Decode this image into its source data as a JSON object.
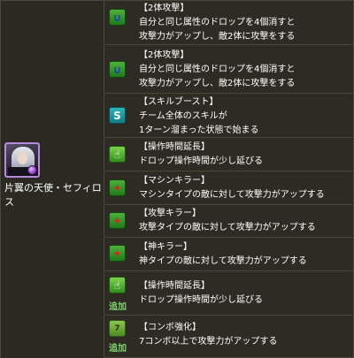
{
  "monster": {
    "name": "片翼の天使・セフィロス",
    "icon": "sephiroth-portrait",
    "attribute_color": "#b88adf"
  },
  "awakenings": [
    {
      "icon": "two-pronged-attack-icon",
      "title": "【2体攻撃】",
      "lines": [
        "自分と同じ属性のドロップを4個消すと",
        "攻撃力がアップし、敵2体に攻撃をする"
      ]
    },
    {
      "icon": "two-pronged-attack-icon",
      "title": "【2体攻撃】",
      "lines": [
        "自分と同じ属性のドロップを4個消すと",
        "攻撃力がアップし、敵2体に攻撃をする"
      ]
    },
    {
      "icon": "skill-boost-icon",
      "title": "【スキルブースト】",
      "lines": [
        "チーム全体のスキルが",
        "1ターン溜まった状態で始まる"
      ]
    },
    {
      "icon": "extend-time-icon",
      "title": "【操作時間延長】",
      "lines": [
        "ドロップ操作時間が少し延びる"
      ]
    },
    {
      "icon": "machine-killer-icon",
      "title": "【マシンキラー】",
      "lines": [
        "マシンタイプの敵に対して攻撃力がアップする"
      ]
    },
    {
      "icon": "attacker-killer-icon",
      "title": "【攻撃キラー】",
      "lines": [
        "攻撃タイプの敵に対して攻撃力がアップする"
      ]
    },
    {
      "icon": "god-killer-icon",
      "title": "【神キラー】",
      "lines": [
        "神タイプの敵に対して攻撃力がアップする"
      ]
    },
    {
      "icon": "extend-time-icon",
      "title": "【操作時間延長】",
      "lines": [
        "ドロップ操作時間が少し延びる"
      ],
      "badge": "追加"
    },
    {
      "icon": "enhanced-combo-icon",
      "title": "【コンボ強化】",
      "lines": [
        "7コンボ以上で攻撃力がアップする"
      ],
      "badge": "追加"
    }
  ]
}
